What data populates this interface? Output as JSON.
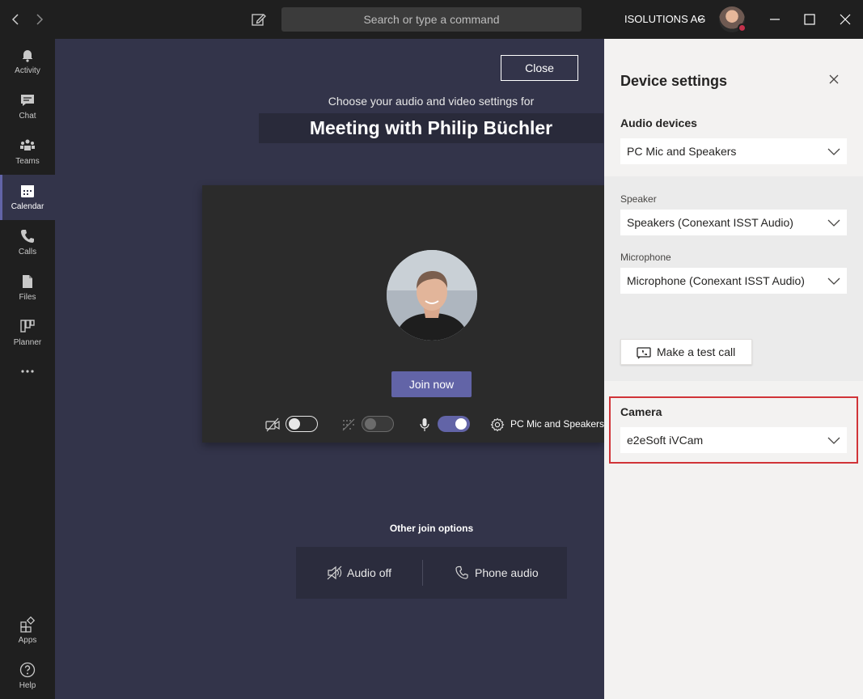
{
  "titlebar": {
    "search_placeholder": "Search or type a command",
    "org_name": "ISOLUTIONS AG"
  },
  "rail": {
    "items": [
      {
        "label": "Activity",
        "icon": "bell-icon"
      },
      {
        "label": "Chat",
        "icon": "chat-icon"
      },
      {
        "label": "Teams",
        "icon": "teams-icon"
      },
      {
        "label": "Calendar",
        "icon": "calendar-icon",
        "active": true
      },
      {
        "label": "Calls",
        "icon": "phone-icon"
      },
      {
        "label": "Files",
        "icon": "file-icon"
      },
      {
        "label": "Planner",
        "icon": "planner-icon"
      }
    ],
    "bottom": [
      {
        "label": "Apps",
        "icon": "apps-icon"
      },
      {
        "label": "Help",
        "icon": "help-icon"
      }
    ]
  },
  "main": {
    "close_label": "Close",
    "choose_text": "Choose your audio and video settings for",
    "meeting_title": "Meeting with Philip Büchler",
    "join_label": "Join now",
    "device_label": "PC Mic and Speakers",
    "camera_on": false,
    "blur_on": false,
    "mic_on": true,
    "other_title": "Other join options",
    "audio_off_label": "Audio off",
    "phone_audio_label": "Phone audio"
  },
  "panel": {
    "title": "Device settings",
    "audio_heading": "Audio devices",
    "audio_value": "PC Mic and Speakers",
    "speaker_label": "Speaker",
    "speaker_value": "Speakers (Conexant ISST Audio)",
    "mic_label": "Microphone",
    "mic_value": "Microphone (Conexant ISST Audio)",
    "test_call_label": "Make a test call",
    "camera_heading": "Camera",
    "camera_value": "e2eSoft iVCam"
  },
  "colors": {
    "accent": "#6264a7",
    "highlight": "#d13438",
    "presence_busy": "#c4314b"
  }
}
